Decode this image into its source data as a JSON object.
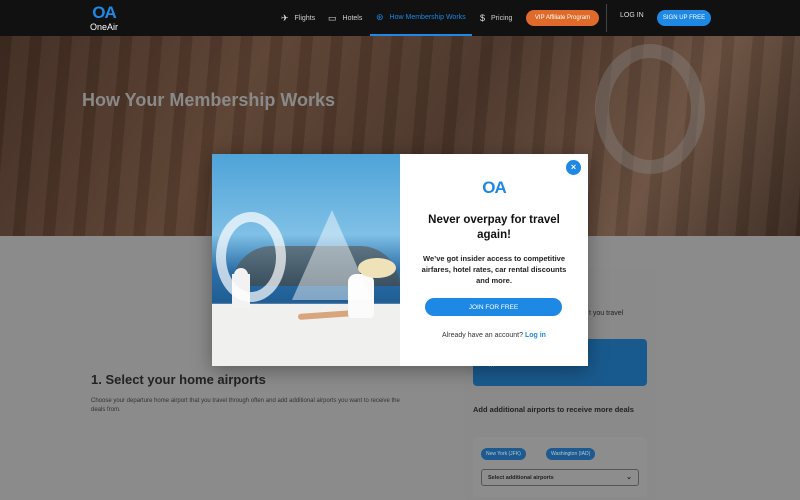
{
  "header": {
    "logo_mark": "OA",
    "logo_word": "OneAir",
    "nav": [
      {
        "label": "Flights",
        "icon": "plane-icon"
      },
      {
        "label": "Hotels",
        "icon": "bed-icon"
      },
      {
        "label": "How Membership Works",
        "icon": "help-icon"
      },
      {
        "label": "Pricing",
        "icon": "dollar-icon"
      }
    ],
    "vip_label": "VIP Affiliate Program",
    "login_label": "LOG IN",
    "signup_label": "SIGN UP FREE"
  },
  "hero": {
    "title": "How Your Membership Works"
  },
  "steps": {
    "title": "1. Select your home airports",
    "description": "Choose your departure home airport that you travel through often and add additional airports you want to receive the deals from."
  },
  "card": {
    "partial_text": "t you travel",
    "blue_text": "…",
    "add_airports_label": "Add additional airports to receive more deals",
    "chips": [
      "New York (JFK)",
      "Washington (IAD)"
    ],
    "select_placeholder": "Select additional airports"
  },
  "modal": {
    "logo": "OA",
    "title": "Never overpay for travel again!",
    "subtitle": "We’ve got insider access to competitive airfares, hotel rates, car rental discounts and more.",
    "join_label": "JOIN FOR FREE",
    "account_text": "Already have an account?",
    "login_link": "Log in",
    "close": "×"
  },
  "colors": {
    "accent": "#1e88e5",
    "vip": "#e06a2a",
    "header_bg": "#111111"
  }
}
